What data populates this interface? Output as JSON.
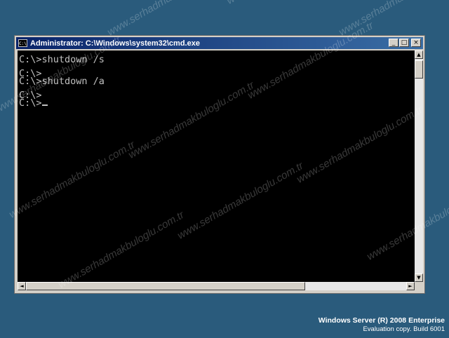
{
  "window": {
    "title": "Administrator: C:\\Windows\\system32\\cmd.exe",
    "app_icon_text": "C:\\",
    "minimize": "_",
    "maximize": "□",
    "close": "×"
  },
  "console": {
    "lines": [
      "",
      "C:\\>shutdown /s",
      "",
      "C:\\>",
      "C:\\>shutdown /a",
      "",
      "C:\\>",
      "C:\\>"
    ],
    "text_color": "#c0c0c0",
    "background": "#000000"
  },
  "scrollbar": {
    "up": "▲",
    "down": "▼",
    "left": "◄",
    "right": "►"
  },
  "watermark": "www.serhadmakbuloglu.com.tr",
  "branding": {
    "product": "Windows Server (R) 2008 Enterprise",
    "build": "Evaluation copy. Build 6001"
  },
  "colors": {
    "desktop": "#2a5b7c",
    "titlebar_start": "#0a246a",
    "titlebar_end": "#3a6ea5"
  }
}
